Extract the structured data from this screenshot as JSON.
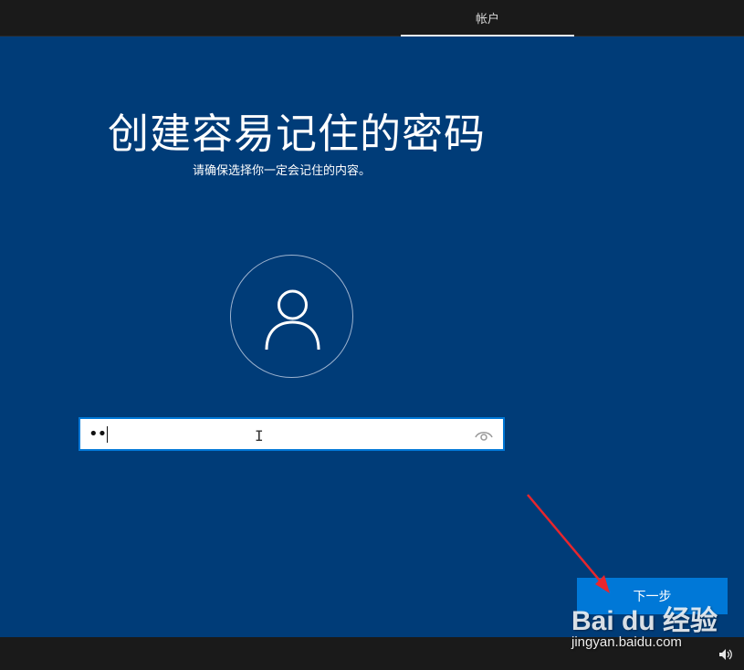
{
  "header": {
    "tab_label": "帐户"
  },
  "main": {
    "title": "创建容易记住的密码",
    "subtitle": "请确保选择你一定会记住的内容。",
    "password": {
      "value": "••"
    }
  },
  "footer": {
    "next_label": "下一步"
  },
  "watermark": {
    "logo": "Bai du 经验",
    "url": "jingyan.baidu.com"
  },
  "icons": {
    "avatar": "user-icon",
    "reveal": "eye-icon",
    "volume": "speaker-icon"
  },
  "colors": {
    "background": "#003c78",
    "accent": "#0078d7",
    "topbar": "#1a1a1a",
    "arrow": "#e8262d"
  }
}
